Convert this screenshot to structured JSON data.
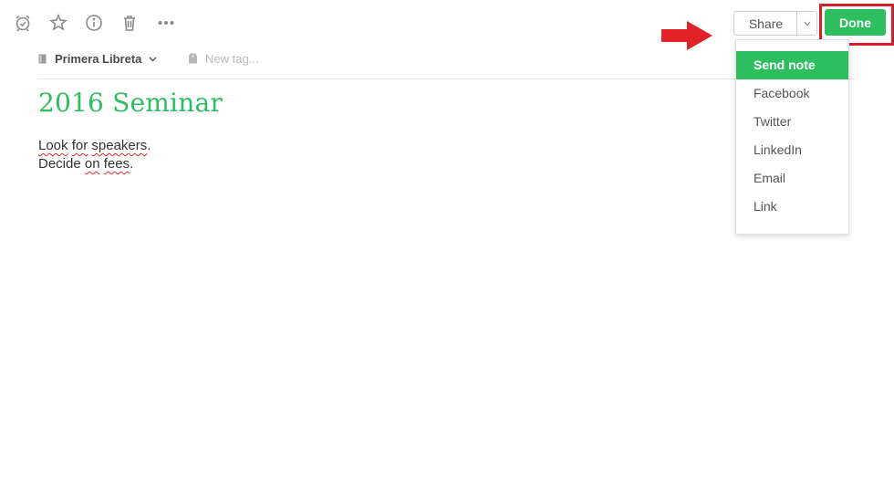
{
  "toolbar": {
    "icons": [
      "reminder-alarm-icon",
      "star-icon",
      "info-icon",
      "trash-icon",
      "more-icon"
    ]
  },
  "note": {
    "notebook": "Primera Libreta",
    "tag_placeholder": "New tag...",
    "title": "2016 Seminar",
    "body_line1": {
      "w1": "Look",
      "w2": "for",
      "w3": "speakers",
      "end": "."
    },
    "body_line2": {
      "w1": "Decide",
      "w2": "on",
      "w3": "fees",
      "end": "."
    }
  },
  "share": {
    "label": "Share",
    "done_label": "Done",
    "menu": [
      {
        "label": "Send note",
        "active": true
      },
      {
        "label": "Facebook",
        "active": false
      },
      {
        "label": "Twitter",
        "active": false
      },
      {
        "label": "LinkedIn",
        "active": false
      },
      {
        "label": "Email",
        "active": false
      },
      {
        "label": "Link",
        "active": false
      }
    ]
  },
  "colors": {
    "accent": "#2dbe60",
    "annotation": "#d3202a",
    "misspell": "#e0302f"
  }
}
